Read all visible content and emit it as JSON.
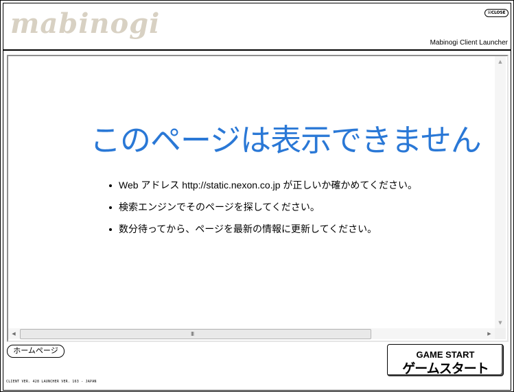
{
  "header": {
    "logo_text": "mabinogi",
    "close_label": "☒CLOSE",
    "launcher_title": "Mabinogi Client Launcher"
  },
  "browser": {
    "error_title": "このページは表示できません",
    "error_items": [
      "Web アドレス http://static.nexon.co.jp が正しいか確かめてください。",
      "検索エンジンでそのページを探してください。",
      "数分待ってから、ページを最新の情報に更新してください。"
    ],
    "scroll_grip": "III"
  },
  "footer": {
    "home_label": "ホームページ",
    "start_label_en": "GAME START",
    "start_label_jp": "ゲームスタート",
    "version_text": "CLIENT VER. 428  LAUNCHER VER. 163 - JAPAN"
  },
  "colors": {
    "error_title": "#2a78d6",
    "logo": "#d8d1c3"
  }
}
